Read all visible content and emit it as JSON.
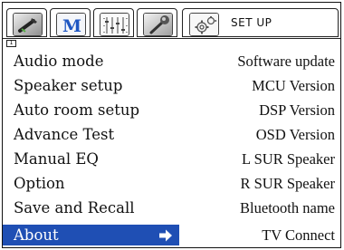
{
  "tabs": [
    {
      "icon": "wrench-icon"
    },
    {
      "icon": "m-logo-icon",
      "text": "M"
    },
    {
      "icon": "equalizer-icon"
    },
    {
      "icon": "microphone-icon"
    },
    {
      "icon": "gear-icon",
      "label": "SET UP"
    }
  ],
  "page_indicator": "1",
  "left_menu": [
    {
      "label": "Audio mode"
    },
    {
      "label": "Speaker setup"
    },
    {
      "label": "Auto room setup"
    },
    {
      "label": "Advance Test"
    },
    {
      "label": "Manual EQ"
    },
    {
      "label": "Option"
    },
    {
      "label": "Save and Recall"
    },
    {
      "label": "About",
      "selected": true
    }
  ],
  "right_menu": [
    "Software update",
    "MCU Version",
    "DSP Version",
    "OSD Version",
    "L SUR Speaker",
    "R SUR Speaker",
    "Bluetooth name",
    "TV Connect"
  ],
  "colors": {
    "selection": "#1f4fb4",
    "m_logo": "#1e56c2"
  }
}
